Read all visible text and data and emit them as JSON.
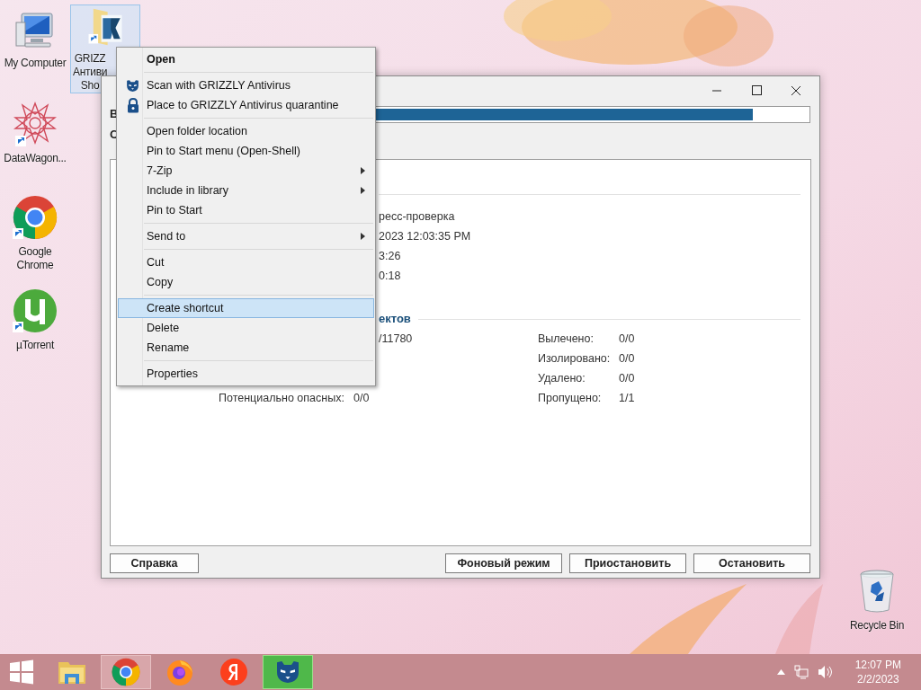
{
  "desktop_icons": [
    {
      "kind": "computer",
      "label_lines": [
        "My Computer"
      ],
      "selected": false
    },
    {
      "kind": "grizzly",
      "label_lines": [
        "GRIZZ",
        "Антиви",
        "Sho"
      ],
      "selected": true
    },
    {
      "kind": "datawagon",
      "label_lines": [
        "DataWagon..."
      ],
      "selected": false
    },
    {
      "kind": "chrome",
      "label_lines": [
        "Google",
        "Chrome"
      ],
      "selected": false
    },
    {
      "kind": "torrent",
      "label_lines": [
        "µTorrent"
      ],
      "selected": false
    },
    {
      "kind": "recycle",
      "label_lines": [
        "Recycle Bin"
      ],
      "selected": false
    }
  ],
  "window": {
    "header_fragments": [
      "В",
      "С"
    ],
    "progress": {
      "level": 0.91
    },
    "info_rows": [
      "ресс-проверка",
      "2023 12:03:35 PM",
      "3:26",
      "0:18"
    ],
    "section_title": "ектов",
    "stats": [
      {
        "left_value": "/11780",
        "right_label": "Вылечено:",
        "right_value": "0/0"
      },
      {
        "right_label": "Изолировано:",
        "right_value": "0/0"
      },
      {
        "right_label": "Удалено:",
        "right_value": "0/0"
      },
      {
        "left_label": "Потенциально опасных:",
        "left_value": "0/0",
        "right_label": "Пропущено:",
        "right_value": "1/1"
      }
    ],
    "buttons": [
      "Справка",
      "Фоновый режим",
      "Приостановить",
      "Остановить"
    ]
  },
  "context_menu": {
    "groups": [
      [
        {
          "label": "Open",
          "kind": "plain",
          "bold": true,
          "submenu": false,
          "selected": false
        }
      ],
      [
        {
          "label": "Scan with GRIZZLY Antivirus",
          "kind": "bear",
          "bold": false,
          "submenu": false,
          "selected": false
        },
        {
          "label": "Place to GRIZZLY Antivirus quarantine",
          "kind": "lock",
          "bold": false,
          "submenu": false,
          "selected": false
        }
      ],
      [
        {
          "label": "Open folder location",
          "kind": "plain",
          "bold": false,
          "submenu": false,
          "selected": false
        },
        {
          "label": "Pin to Start menu (Open-Shell)",
          "kind": "plain",
          "bold": false,
          "submenu": false,
          "selected": false
        },
        {
          "label": "7-Zip",
          "kind": "plain",
          "bold": false,
          "submenu": true,
          "selected": false
        },
        {
          "label": "Include in library",
          "kind": "plain",
          "bold": false,
          "submenu": true,
          "selected": false
        },
        {
          "label": "Pin to Start",
          "kind": "plain",
          "bold": false,
          "submenu": false,
          "selected": false
        }
      ],
      [
        {
          "label": "Send to",
          "kind": "plain",
          "bold": false,
          "submenu": true,
          "selected": false
        }
      ],
      [
        {
          "label": "Cut",
          "kind": "plain",
          "bold": false,
          "submenu": false,
          "selected": false
        },
        {
          "label": "Copy",
          "kind": "plain",
          "bold": false,
          "submenu": false,
          "selected": false
        }
      ],
      [
        {
          "label": "Create shortcut",
          "kind": "plain",
          "bold": false,
          "submenu": false,
          "selected": true
        },
        {
          "label": "Delete",
          "kind": "plain",
          "bold": false,
          "submenu": false,
          "selected": false
        },
        {
          "label": "Rename",
          "kind": "plain",
          "bold": false,
          "submenu": false,
          "selected": false
        }
      ],
      [
        {
          "label": "Properties",
          "kind": "plain",
          "bold": false,
          "submenu": false,
          "selected": false
        }
      ]
    ]
  },
  "taskbar": {
    "items": [
      {
        "kind": "start",
        "selected": false,
        "hovered": false
      },
      {
        "kind": "explorer",
        "selected": false,
        "hovered": false
      },
      {
        "kind": "chrome",
        "selected": false,
        "hovered": true
      },
      {
        "kind": "firefox",
        "selected": false,
        "hovered": false
      },
      {
        "kind": "yandex",
        "selected": false,
        "hovered": false
      },
      {
        "kind": "grizzly",
        "selected": true,
        "hovered": false
      }
    ],
    "clock": {
      "time": "12:07 PM",
      "date": "2/2/2023"
    }
  }
}
